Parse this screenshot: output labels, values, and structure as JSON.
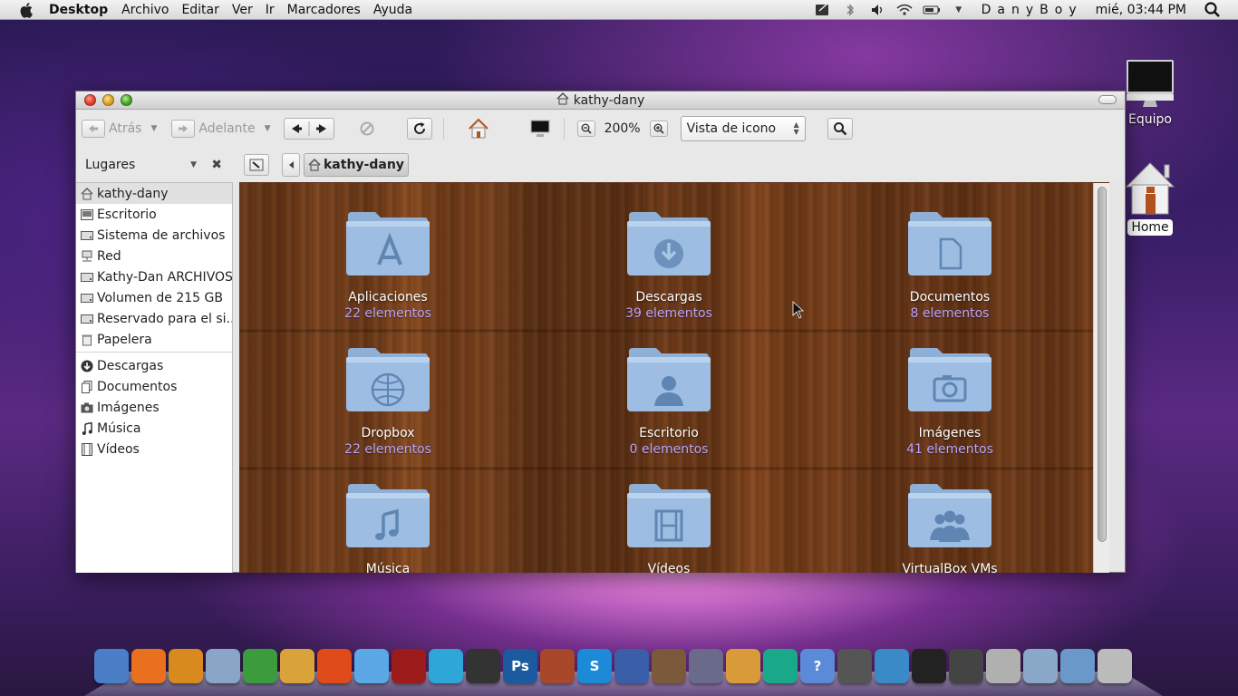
{
  "menubar": {
    "app_name": "Desktop",
    "menus": [
      "Archivo",
      "Editar",
      "Ver",
      "Ir",
      "Marcadores",
      "Ayuda"
    ],
    "user": "DanyBoy",
    "clock": "mié, 03:44 PM",
    "status_icons": [
      "notes-icon",
      "bluetooth-icon",
      "volume-icon",
      "wifi-icon",
      "battery-icon",
      "dropdown-icon",
      "search-icon"
    ]
  },
  "window": {
    "title": "kathy-dany",
    "toolbar": {
      "back_label": "Atrás",
      "forward_label": "Adelante",
      "zoom_level": "200%",
      "view_mode": "Vista de icono"
    },
    "places_label": "Lugares",
    "breadcrumb": "kathy-dany",
    "sidebar": {
      "places": [
        {
          "label": "kathy-dany",
          "icon": "home-icon",
          "selected": true
        },
        {
          "label": "Escritorio",
          "icon": "desktop-icon",
          "selected": false
        },
        {
          "label": "Sistema de archivos",
          "icon": "drive-icon",
          "selected": false
        },
        {
          "label": "Red",
          "icon": "network-icon",
          "selected": false
        },
        {
          "label": "Kathy-Dan ARCHIVOS",
          "icon": "drive-icon",
          "selected": false
        },
        {
          "label": "Volumen de 215 GB",
          "icon": "drive-icon",
          "selected": false
        },
        {
          "label": "Reservado para el si...",
          "icon": "drive-icon",
          "selected": false
        },
        {
          "label": "Papelera",
          "icon": "trash-icon",
          "selected": false
        }
      ],
      "bookmarks": [
        {
          "label": "Descargas",
          "icon": "download-icon"
        },
        {
          "label": "Documentos",
          "icon": "documents-icon"
        },
        {
          "label": "Imágenes",
          "icon": "camera-icon"
        },
        {
          "label": "Música",
          "icon": "music-icon"
        },
        {
          "label": "Vídeos",
          "icon": "film-icon"
        }
      ]
    },
    "items": [
      {
        "name": "Aplicaciones",
        "count": "22 elementos",
        "icon": "applications-folder-icon"
      },
      {
        "name": "Descargas",
        "count": "39 elementos",
        "icon": "downloads-folder-icon"
      },
      {
        "name": "Documentos",
        "count": "8 elementos",
        "icon": "documents-folder-icon"
      },
      {
        "name": "Dropbox",
        "count": "22 elementos",
        "icon": "globe-folder-icon"
      },
      {
        "name": "Escritorio",
        "count": "0 elementos",
        "icon": "user-folder-icon"
      },
      {
        "name": "Imágenes",
        "count": "41 elementos",
        "icon": "pictures-folder-icon"
      },
      {
        "name": "Música",
        "count": "",
        "icon": "music-folder-icon"
      },
      {
        "name": "Vídeos",
        "count": "",
        "icon": "movies-folder-icon"
      },
      {
        "name": "VirtualBox VMs",
        "count": "",
        "icon": "group-folder-icon"
      }
    ]
  },
  "desktop": {
    "icons": [
      {
        "label": "Equipo",
        "icon": "computer-icon"
      },
      {
        "label": "Home",
        "icon": "house-icon"
      }
    ]
  },
  "dock": {
    "items": [
      "finder-icon",
      "firefox-icon",
      "thunderbird-icon",
      "mail-icon",
      "pidgin-icon",
      "popcorn-icon",
      "burner-icon",
      "star-icon",
      "photo-booth-icon",
      "monster-icon",
      "linux-penguin-icon",
      "photoshop-icon",
      "firewall-icon",
      "skype-icon",
      "graph-icon",
      "keynote-icon",
      "pen-icon",
      "package-icon",
      "bookmark-icon",
      "help-icon",
      "display-icon",
      "robot-icon",
      "activity-monitor-icon",
      "console-icon",
      "text-editor-icon",
      "pictures-stack-icon",
      "apps-stack-icon",
      "trash-icon"
    ],
    "colors": [
      "#4a7fc8",
      "#e8701f",
      "#d98a1e",
      "#8aa6c7",
      "#3c9b3c",
      "#d9a23a",
      "#e04b1a",
      "#5aa8e6",
      "#9c1b1b",
      "#2fa6d8",
      "#333333",
      "#1c5aa0",
      "#a8472a",
      "#1d8ad8",
      "#3a5fa8",
      "#7a5a3a",
      "#6a6a8a",
      "#d99a3a",
      "#1aa88a",
      "#5a8ad8",
      "#555555",
      "#3a8ac8",
      "#222222",
      "#444444",
      "#b0b0b0",
      "#8aa8c8",
      "#6a98c8",
      "#bbbbbb"
    ]
  }
}
